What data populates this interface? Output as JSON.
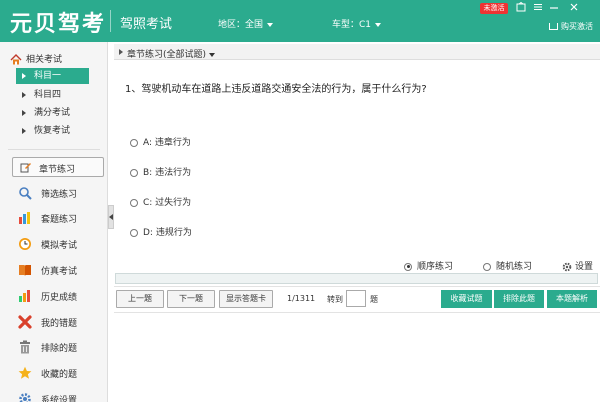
{
  "header": {
    "logo": "元贝驾考",
    "subtitle": "驾照考试",
    "region": "地区：全国",
    "car_type": "车型：C1",
    "badge": "未激活",
    "buy": "购买激活",
    "accent_color": "#2bab8e"
  },
  "sidebar": {
    "heading": "相关考试",
    "subjects": [
      "科目一",
      "科目四",
      "满分考试",
      "恢复考试"
    ],
    "active_subject": "科目一",
    "chapter_button": "章节练习",
    "menu": [
      {
        "label": "筛选练习",
        "icon": "search-icon"
      },
      {
        "label": "套题练习",
        "icon": "bar-chart-icon"
      },
      {
        "label": "模拟考试",
        "icon": "clock-icon"
      },
      {
        "label": "仿真考试",
        "icon": "book-icon"
      },
      {
        "label": "历史成绩",
        "icon": "history-icon"
      },
      {
        "label": "我的错题",
        "icon": "cross-icon"
      },
      {
        "label": "排除的题",
        "icon": "trash-icon"
      },
      {
        "label": "收藏的题",
        "icon": "star-icon"
      },
      {
        "label": "系统设置",
        "icon": "gear-icon"
      }
    ]
  },
  "main": {
    "breadcrumb": "章节练习(全部试题)",
    "question": "1、驾驶机动车在道路上违反道路交通安全法的行为，属于什么行为?",
    "options": [
      "A: 违章行为",
      "B: 违法行为",
      "C: 过失行为",
      "D: 违规行为"
    ],
    "mode": {
      "sequential": "顺序练习",
      "random": "随机练习",
      "settings": "设置",
      "selected": "顺序练习"
    },
    "nav": {
      "prev": "上一题",
      "next": "下一题",
      "show_card": "显示答题卡",
      "progress": "1/1311",
      "goto": "转到",
      "goto_suffix": "题",
      "goto_value": "",
      "favorite": "收藏试题",
      "exclude": "排除此题",
      "explain": "本题解析"
    }
  }
}
